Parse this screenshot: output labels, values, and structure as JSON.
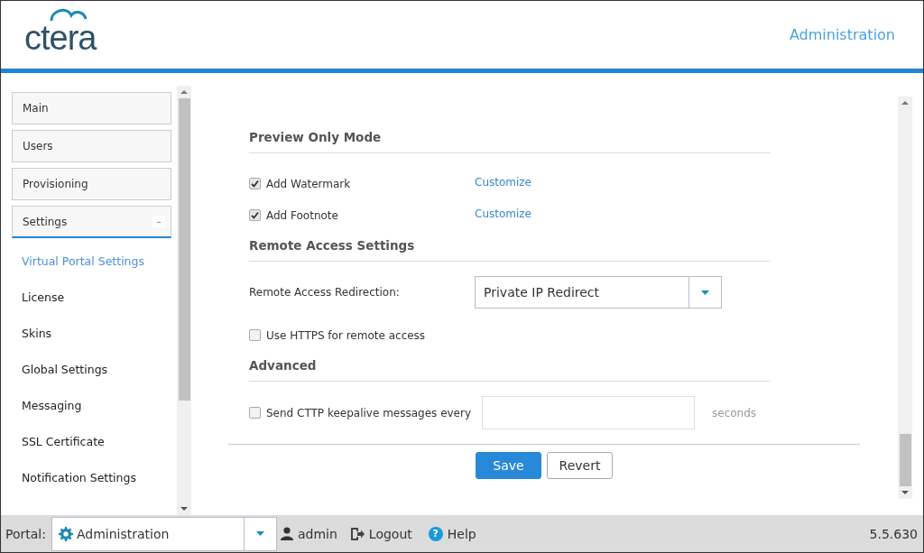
{
  "header": {
    "logo": "ctera",
    "title": "Administration"
  },
  "sidebar": {
    "sections": [
      {
        "label": "Main",
        "expanded": false
      },
      {
        "label": "Users",
        "expanded": false
      },
      {
        "label": "Provisioning",
        "expanded": false
      },
      {
        "label": "Settings",
        "expanded": true,
        "toggle": "–"
      }
    ],
    "items": [
      {
        "label": "Virtual Portal Settings",
        "selected": true
      },
      {
        "label": "License",
        "selected": false
      },
      {
        "label": "Skins",
        "selected": false
      },
      {
        "label": "Global Settings",
        "selected": false
      },
      {
        "label": "Messaging",
        "selected": false
      },
      {
        "label": "SSL Certificate",
        "selected": false
      },
      {
        "label": "Notification Settings",
        "selected": false
      }
    ]
  },
  "sections": [
    {
      "title": "Preview Only Mode",
      "rows": [
        {
          "kind": "checkbox",
          "label": "Add Watermark",
          "checked": true,
          "link": "Customize"
        },
        {
          "kind": "checkbox",
          "label": "Add Footnote",
          "checked": true,
          "link": "Customize"
        }
      ]
    },
    {
      "title": "Remote Access Settings",
      "rows": [
        {
          "kind": "select",
          "label": "Remote Access Redirection:",
          "value": "Private IP Redirect"
        },
        {
          "kind": "checkbox",
          "label": "Use HTTPS for remote access",
          "checked": false
        }
      ]
    },
    {
      "title": "Advanced",
      "rows": [
        {
          "kind": "checkbox-input",
          "label": "Send CTTP keepalive messages every",
          "checked": false,
          "unit": "seconds"
        }
      ]
    }
  ],
  "buttons": [
    {
      "label": "Save",
      "primary": true
    },
    {
      "label": "Revert",
      "primary": false
    }
  ],
  "footer": {
    "portal_label": "Portal:",
    "portal_value": "Administration",
    "user": "admin",
    "logout": "Logout",
    "help": "Help",
    "help_icon": "?",
    "version": "5.5.630"
  }
}
